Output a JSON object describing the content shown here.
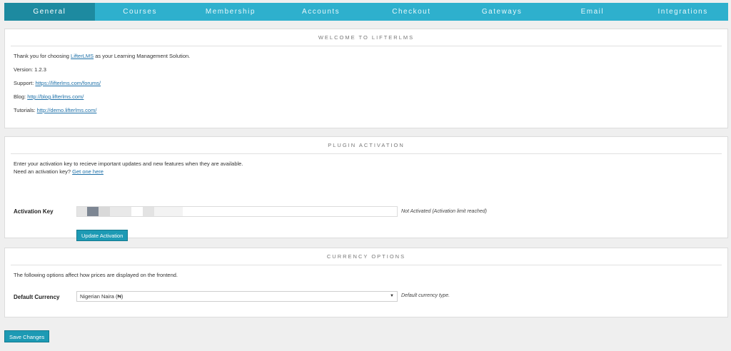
{
  "tabs": [
    {
      "label": "General",
      "active": true
    },
    {
      "label": "Courses"
    },
    {
      "label": "Membership"
    },
    {
      "label": "Accounts"
    },
    {
      "label": "Checkout"
    },
    {
      "label": "Gateways"
    },
    {
      "label": "Email"
    },
    {
      "label": "Integrations"
    }
  ],
  "welcome": {
    "title": "WELCOME TO LIFTERLMS",
    "intro_before": "Thank you for choosing ",
    "intro_link": "LifterLMS",
    "intro_after": " as your Learning Management Solution.",
    "version_label": "Version: 1.2.3",
    "support_label": "Support: ",
    "support_link": "https://lifterlms.com/forums/",
    "blog_label": "Blog: ",
    "blog_link": "http://blog.lifterlms.com/",
    "tutorials_label": "Tutorials: ",
    "tutorials_link": "http://demo.lifterlms.com/"
  },
  "activation": {
    "title": "PLUGIN ACTIVATION",
    "desc1": "Enter your activation key to recieve important updates and new features when they are available.",
    "desc2_before": "Need an activation key? ",
    "desc2_link": "Get one here",
    "key_label": "Activation Key",
    "status": "Not Activated (Activation limit reached)",
    "update_button": "Update Activation"
  },
  "currency": {
    "title": "CURRENCY OPTIONS",
    "desc": "The following options affect how prices are displayed on the frontend.",
    "label": "Default Currency",
    "selected": "Nigerian Naira (₦)",
    "note": "Default currency type."
  },
  "save_button": "Save Changes"
}
